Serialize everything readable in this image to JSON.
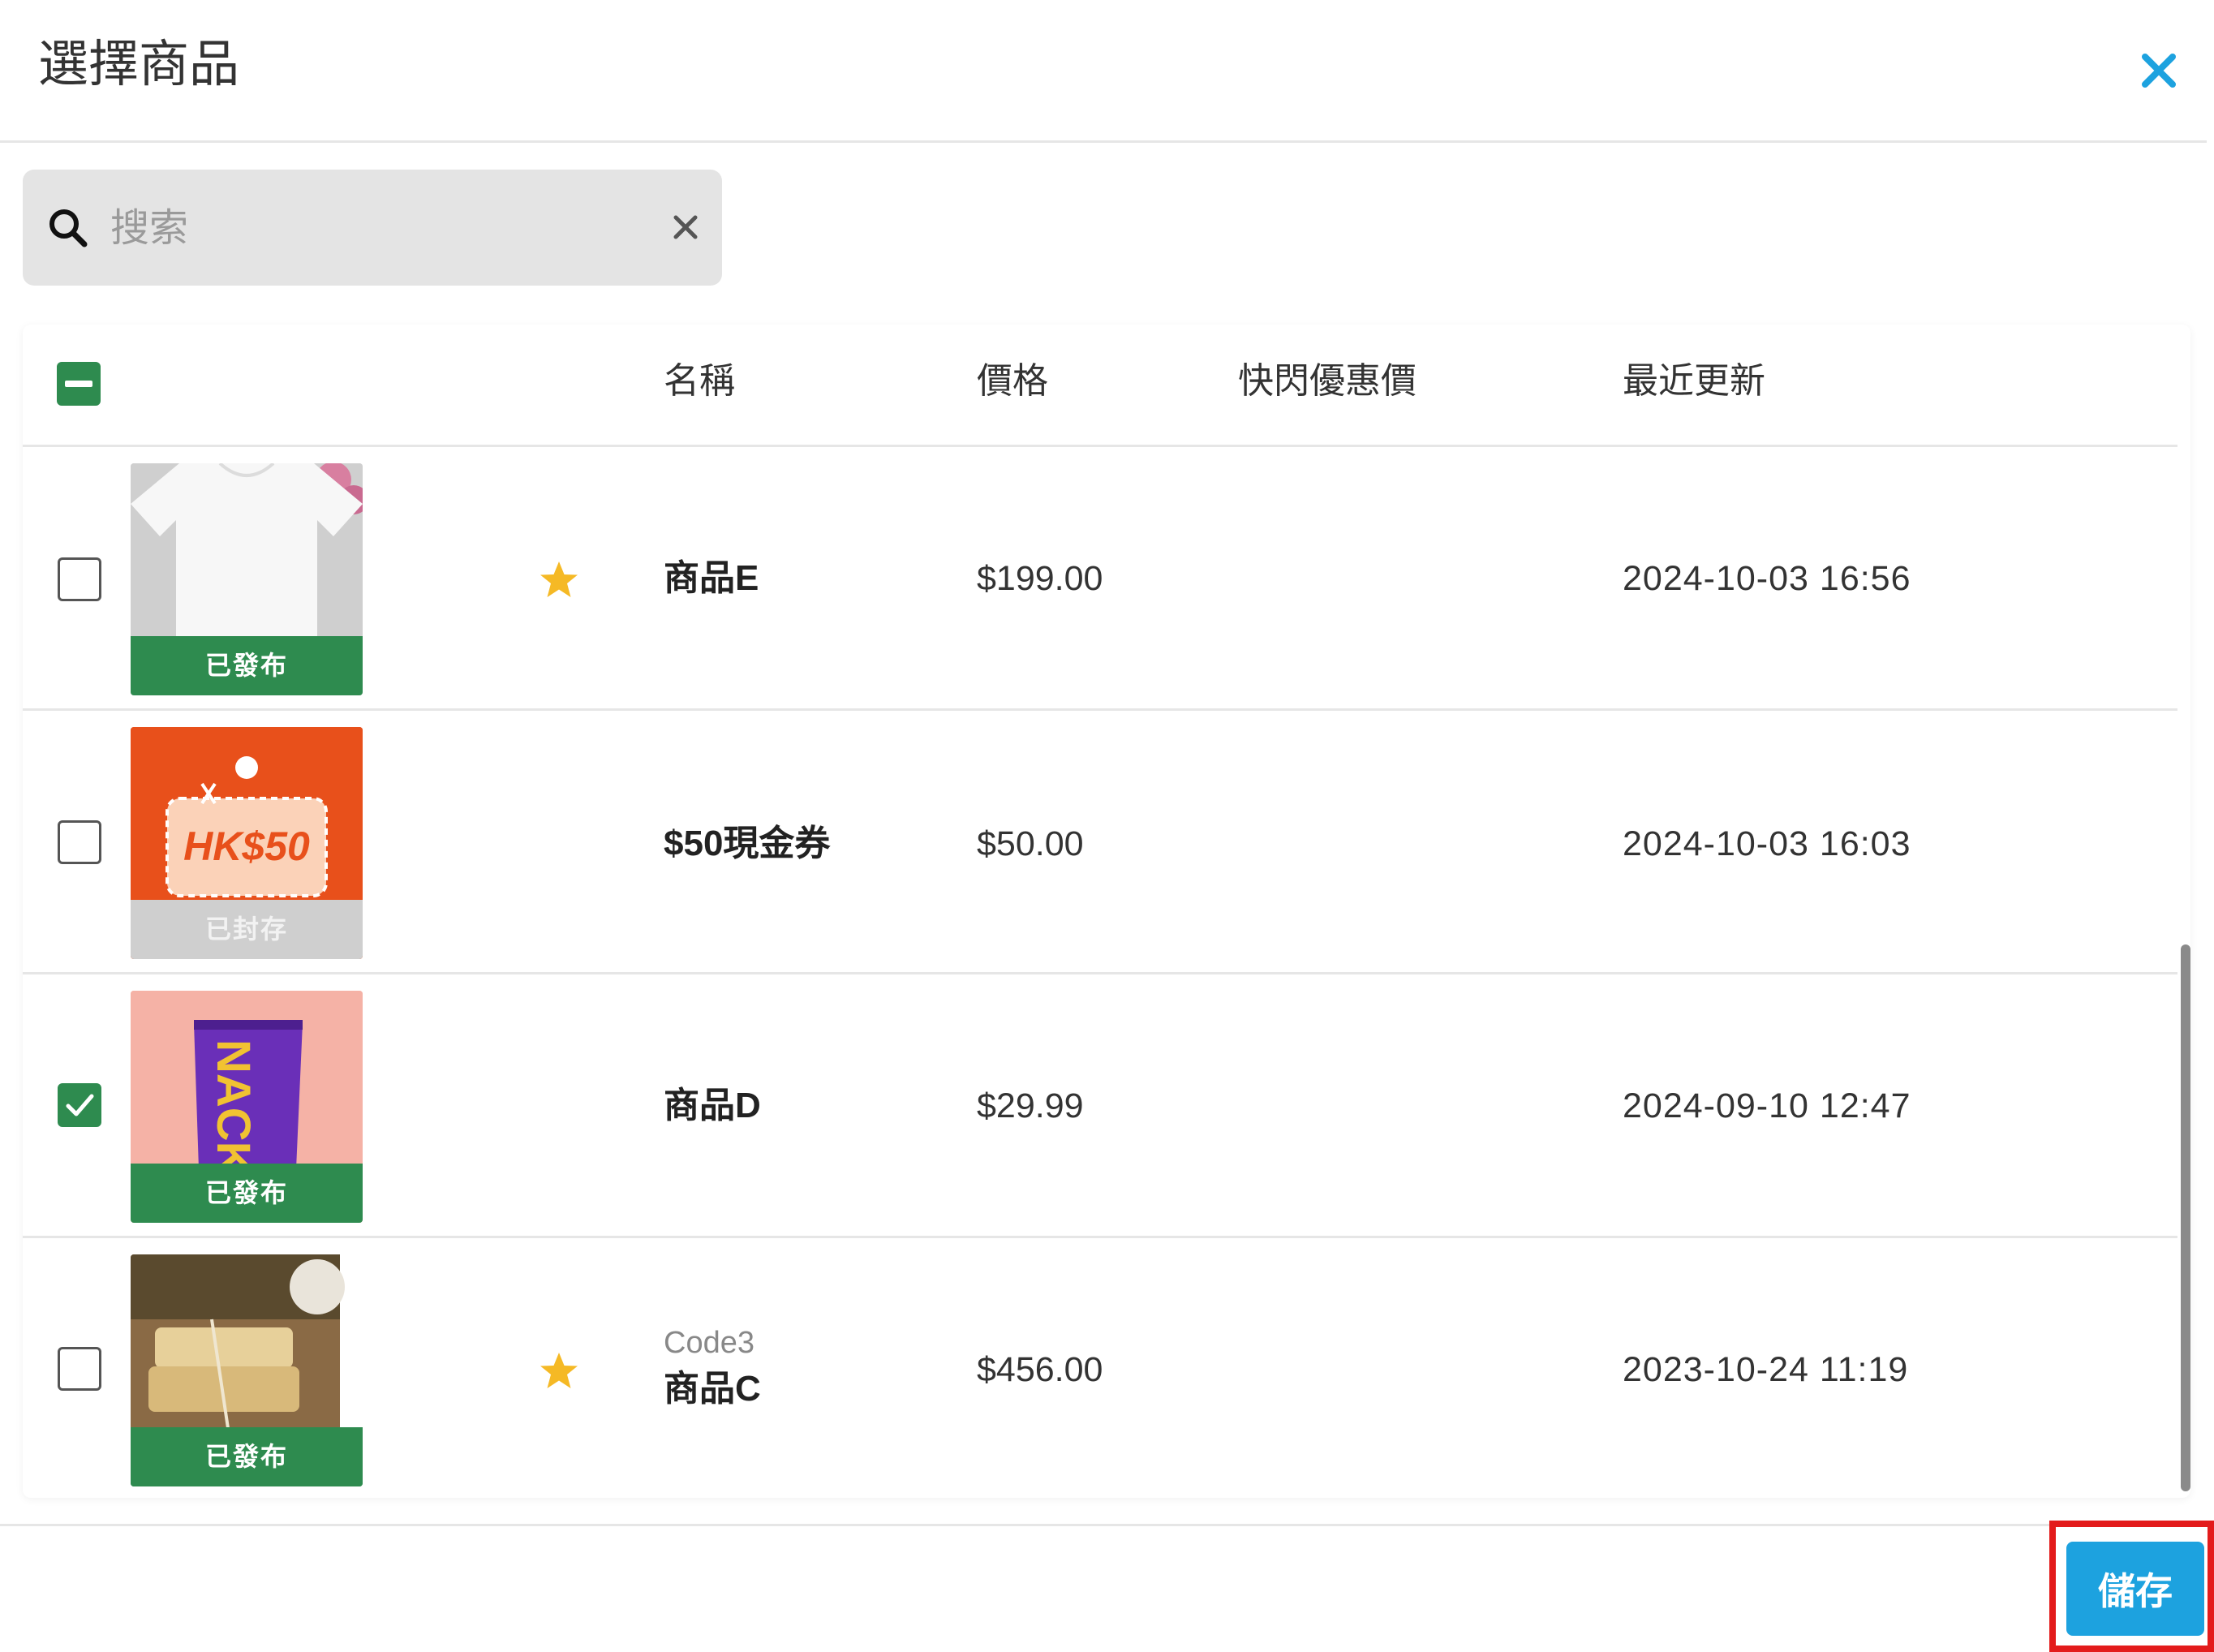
{
  "dialog": {
    "title": "選擇商品"
  },
  "search": {
    "placeholder": "搜索",
    "value": ""
  },
  "table": {
    "headers": {
      "name": "名稱",
      "price": "價格",
      "flash_price": "快閃優惠價",
      "updated": "最近更新"
    },
    "rows": [
      {
        "code": "",
        "name": "商品E",
        "price": "$199.00",
        "flash_price": "",
        "updated": "2024-10-03 16:56",
        "status": "已發布",
        "starred": true,
        "checked": false
      },
      {
        "code": "",
        "name": "$50現金券",
        "price": "$50.00",
        "flash_price": "",
        "updated": "2024-10-03 16:03",
        "status": "已封存",
        "starred": false,
        "checked": false,
        "thumb_text": "HK$50"
      },
      {
        "code": "",
        "name": "商品D",
        "price": "$29.99",
        "flash_price": "",
        "updated": "2024-09-10 12:47",
        "status": "已發布",
        "starred": false,
        "checked": true,
        "thumb_text": "NACK"
      },
      {
        "code": "Code3",
        "name": "商品C",
        "price": "$456.00",
        "flash_price": "",
        "updated": "2023-10-24 11:19",
        "status": "已發布",
        "starred": true,
        "checked": false
      }
    ]
  },
  "footer": {
    "save_label": "儲存"
  },
  "colors": {
    "accent": "#1da2df",
    "published": "#2e8b4f",
    "archived": "#cfcfcf",
    "star": "#f5b925",
    "highlight": "#e31b1b"
  }
}
